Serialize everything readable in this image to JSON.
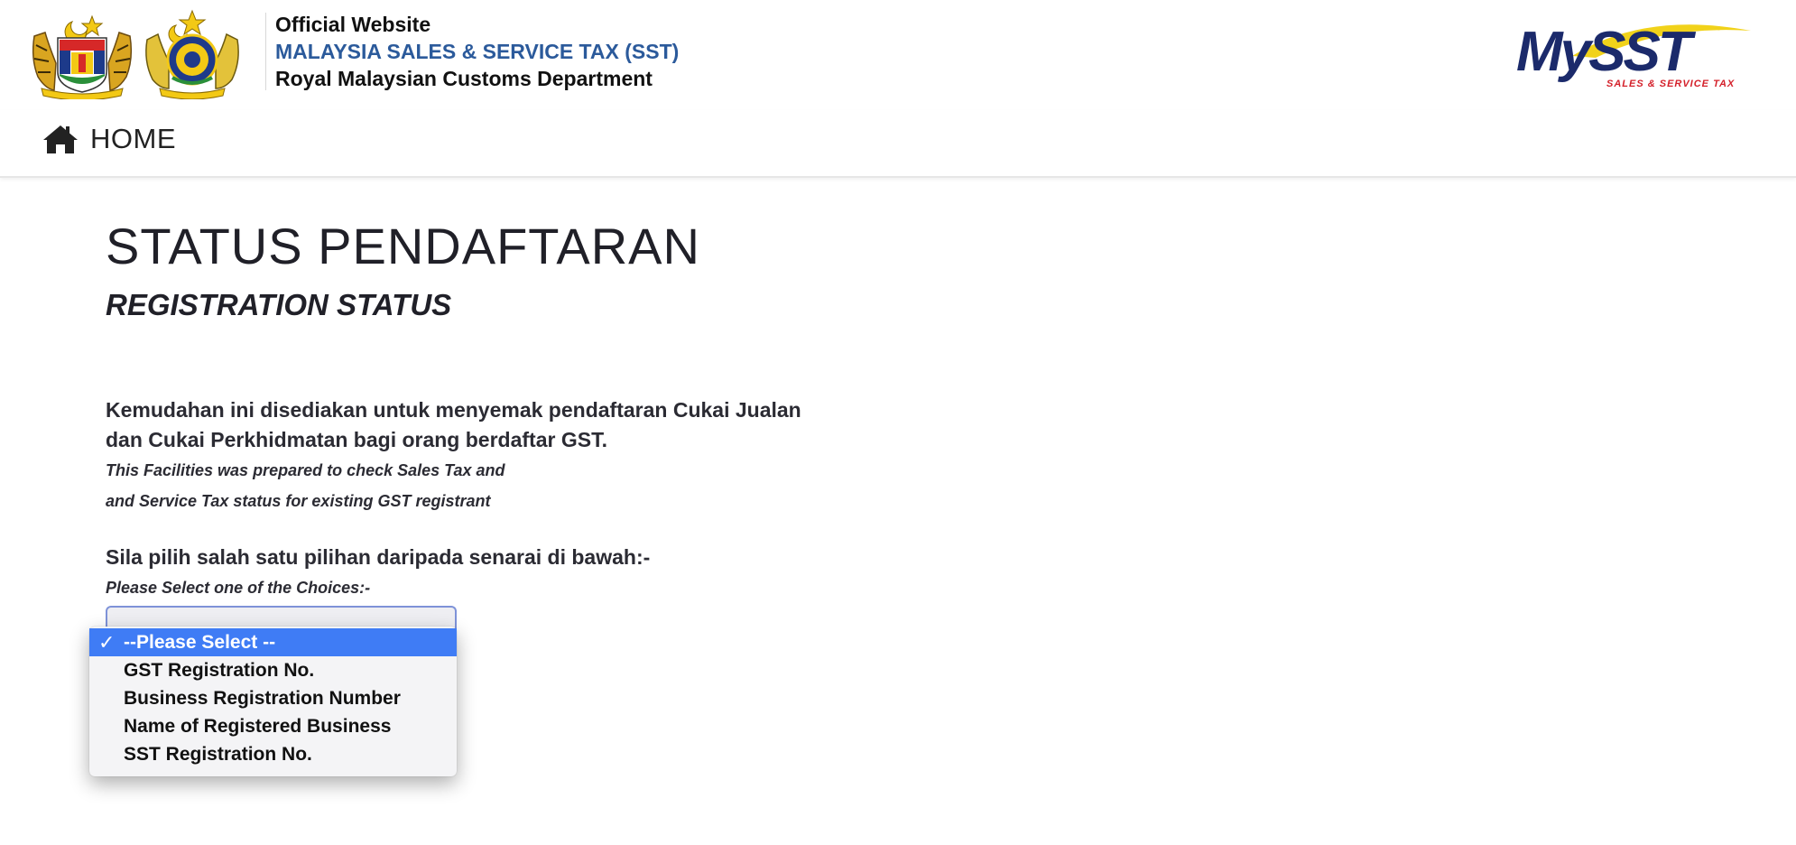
{
  "header": {
    "line1": "Official Website",
    "line2": "MALAYSIA SALES & SERVICE TAX (SST)",
    "line3": "Royal Malaysian Customs Department",
    "logo_left_icon": "malaysia-coat-of-arms-icon",
    "logo_middle_icon": "customs-crest-icon",
    "logo_right": "MySST",
    "logo_right_tag": "SALES & SERVICE TAX"
  },
  "nav": {
    "home_label": "HOME",
    "home_icon": "home-icon"
  },
  "main": {
    "title": "STATUS PENDAFTARAN",
    "subtitle": "REGISTRATION STATUS",
    "desc_ms": "Kemudahan ini disediakan untuk menyemak pendaftaran Cukai Jualan dan Cukai Perkhidmatan bagi orang berdaftar GST.",
    "desc_en_line1": "This Facilities was prepared to check Sales Tax and",
    "desc_en_line2": "and Service Tax status for existing GST registrant",
    "select_prompt_ms": "Sila pilih salah satu pilihan daripada senarai di bawah:-",
    "select_prompt_en": "Please Select one of the Choices:-"
  },
  "dropdown": {
    "selected_index": 0,
    "check_mark": "✓",
    "options": [
      "--Please Select --",
      "GST Registration No.",
      "Business Registration Number",
      "Name of Registered Business",
      "SST Registration No."
    ]
  },
  "colors": {
    "header_accent": "#2b5a9b",
    "selection": "#3f7cf5",
    "logo_navy": "#1b2a6b",
    "logo_yellow": "#f1d21a",
    "logo_red": "#d4202a"
  }
}
